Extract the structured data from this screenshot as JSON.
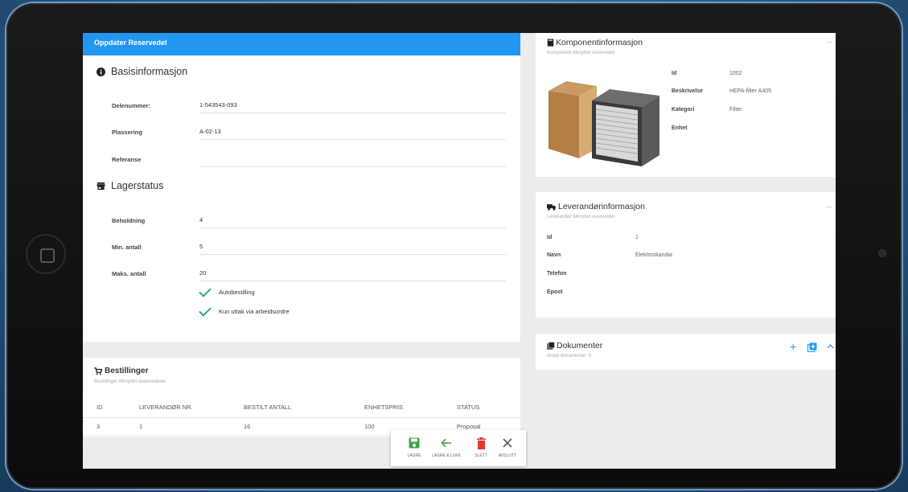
{
  "app": {
    "header_title": "Oppdater Reservedel"
  },
  "basis": {
    "title": "Basisinformasjon",
    "fields": [
      {
        "label": "Delenummer:",
        "value": "1-543543-093"
      },
      {
        "label": "Plassering",
        "value": "A-02-13"
      },
      {
        "label": "Referanse",
        "value": ""
      }
    ]
  },
  "lager": {
    "title": "Lagerstatus",
    "fields": [
      {
        "label": "Beholdning",
        "value": "4"
      },
      {
        "label": "Min. antall",
        "value": "5"
      },
      {
        "label": "Maks. antall",
        "value": "20"
      }
    ],
    "checks": [
      {
        "label": "Autobestilling",
        "checked": true
      },
      {
        "label": "Kun uttak via arbeidsordre",
        "checked": true
      }
    ]
  },
  "orders": {
    "title": "Bestillinger",
    "subtitle": "Bestillinger tilknyttet reservedelen",
    "columns": [
      "ID",
      "LEVERANDØR NR.",
      "BESTILT ANTALL",
      "ENHETSPRIS",
      "STATUS"
    ],
    "rows": [
      [
        "3",
        "1",
        "16",
        "100",
        "Proposal"
      ]
    ]
  },
  "component": {
    "title": "Komponentinformasjon",
    "subtitle": "Komponent tilknyttet reservedel",
    "fields": [
      {
        "label": "Id",
        "value": "1002"
      },
      {
        "label": "Beskrivelse",
        "value": "HEPA-filter A405"
      },
      {
        "label": "Kategori",
        "value": "Filter"
      },
      {
        "label": "Enhet",
        "value": ""
      }
    ]
  },
  "supplier": {
    "title": "Leverandørinformasjon",
    "subtitle": "Leverandør tilknyttet reservedel",
    "fields": [
      {
        "label": "Id",
        "value": "1"
      },
      {
        "label": "Navn",
        "value": "Elektroskandia"
      },
      {
        "label": "Telefon",
        "value": ""
      },
      {
        "label": "Epost",
        "value": ""
      }
    ]
  },
  "documents": {
    "title": "Dokumenter",
    "subtitle": "Antall dokumenter: 0"
  },
  "toolbar": {
    "save": "LAGRE",
    "save_close": "LAGRE & LUKK",
    "delete": "SLETT",
    "close": "AVSLUTT"
  },
  "colors": {
    "primary": "#2196f3",
    "check": "#26a69a",
    "save": "#43a047",
    "delete": "#e53935"
  }
}
